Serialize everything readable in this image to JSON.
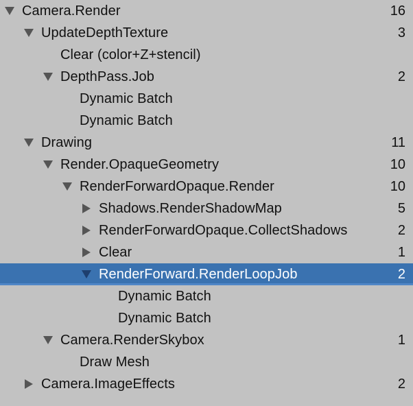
{
  "colors": {
    "background": "#c2c2c2",
    "selection": "#3a72b0",
    "arrow": "#555555",
    "selected_arrow": "#1e3f6e"
  },
  "icons": {
    "expanded": "triangle-down-icon",
    "collapsed": "triangle-right-icon"
  },
  "rows": [
    {
      "label": "Camera.Render",
      "count": "16",
      "depth": 0,
      "arrow": "expanded",
      "selected": false
    },
    {
      "label": "UpdateDepthTexture",
      "count": "3",
      "depth": 1,
      "arrow": "expanded",
      "selected": false
    },
    {
      "label": "Clear (color+Z+stencil)",
      "count": "",
      "depth": 2,
      "arrow": "none",
      "selected": false
    },
    {
      "label": "DepthPass.Job",
      "count": "2",
      "depth": 2,
      "arrow": "expanded",
      "selected": false
    },
    {
      "label": "Dynamic Batch",
      "count": "",
      "depth": 3,
      "arrow": "none",
      "selected": false
    },
    {
      "label": "Dynamic Batch",
      "count": "",
      "depth": 3,
      "arrow": "none",
      "selected": false
    },
    {
      "label": "Drawing",
      "count": "11",
      "depth": 1,
      "arrow": "expanded",
      "selected": false
    },
    {
      "label": "Render.OpaqueGeometry",
      "count": "10",
      "depth": 2,
      "arrow": "expanded",
      "selected": false
    },
    {
      "label": "RenderForwardOpaque.Render",
      "count": "10",
      "depth": 3,
      "arrow": "expanded",
      "selected": false
    },
    {
      "label": "Shadows.RenderShadowMap",
      "count": "5",
      "depth": 4,
      "arrow": "collapsed",
      "selected": false
    },
    {
      "label": "RenderForwardOpaque.CollectShadows",
      "count": "2",
      "depth": 4,
      "arrow": "collapsed",
      "selected": false
    },
    {
      "label": "Clear",
      "count": "1",
      "depth": 4,
      "arrow": "collapsed",
      "selected": false
    },
    {
      "label": "RenderForward.RenderLoopJob",
      "count": "2",
      "depth": 4,
      "arrow": "expanded",
      "selected": true
    },
    {
      "label": "Dynamic Batch",
      "count": "",
      "depth": 5,
      "arrow": "none",
      "selected": false
    },
    {
      "label": "Dynamic Batch",
      "count": "",
      "depth": 5,
      "arrow": "none",
      "selected": false
    },
    {
      "label": "Camera.RenderSkybox",
      "count": "1",
      "depth": 2,
      "arrow": "expanded",
      "selected": false
    },
    {
      "label": "Draw Mesh",
      "count": "",
      "depth": 3,
      "arrow": "none",
      "selected": false
    },
    {
      "label": "Camera.ImageEffects",
      "count": "2",
      "depth": 1,
      "arrow": "collapsed",
      "selected": false
    }
  ]
}
